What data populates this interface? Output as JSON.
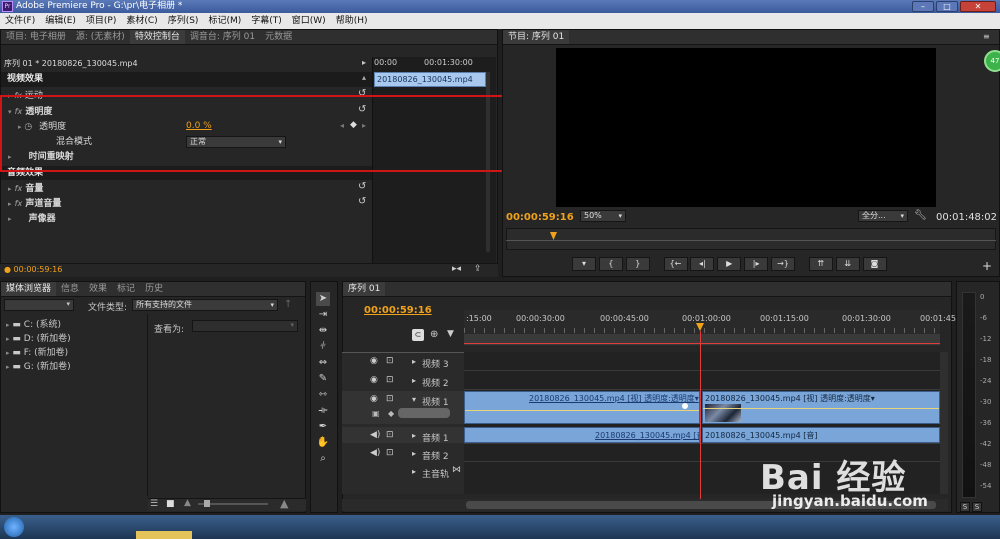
{
  "window": {
    "title": "Adobe Premiere Pro - G:\\pr\\电子相册 *",
    "logo": "Pr"
  },
  "menu": [
    "文件(F)",
    "编辑(E)",
    "项目(P)",
    "素材(C)",
    "序列(S)",
    "标记(M)",
    "字幕(T)",
    "窗口(W)",
    "帮助(H)"
  ],
  "source_panel": {
    "tabs": [
      "项目: 电子相册",
      "源: (无素材)",
      "特效控制台",
      "调音台: 序列 01",
      "元数据"
    ],
    "sequence_clip": "序列 01 * 20180826_130045.mp4",
    "video_effects_label": "视频效果",
    "effects": {
      "motion": "运动",
      "opacity": "透明度",
      "opacity_param": "透明度",
      "opacity_value": "0.0 %",
      "blend_mode_label": "混合模式",
      "blend_mode_value": "正常",
      "time_remap": "时间重映射"
    },
    "audio_effects_label": "音频效果",
    "audio": {
      "volume": "音量",
      "channel_volume": "声道音量",
      "panner": "声像器"
    },
    "mini_timeline": {
      "t0": "00:00",
      "t1": "00:01:30:00",
      "clip": "20180826_130045.mp4"
    },
    "timecode": "00:00:59:16"
  },
  "program_panel": {
    "tab": "节目: 序列 01",
    "current_time": "00:00:59:16",
    "zoom": "50%",
    "quality": "全分...",
    "duration": "00:01:48:02",
    "controls": [
      "marker",
      "in",
      "out",
      "go-in",
      "step-back",
      "play",
      "step-fwd",
      "go-out",
      "lift",
      "extract",
      "export-frame"
    ]
  },
  "media_browser": {
    "tabs": [
      "媒体浏览器",
      "信息",
      "效果",
      "标记",
      "历史"
    ],
    "file_type_label": "文件类型:",
    "file_type_value": "所有支持的文件",
    "view_as_label": "查看为:",
    "drives": [
      "C: (系统)",
      "D: (新加卷)",
      "F: (新加卷)",
      "G: (新加卷)"
    ]
  },
  "timeline": {
    "tab": "序列 01",
    "timecode": "00:00:59:16",
    "ruler": [
      ":15:00",
      "00:00:30:00",
      "00:00:45:00",
      "00:01:00:00",
      "00:01:15:00",
      "00:01:30:00",
      "00:01:45"
    ],
    "tracks": {
      "v3": "视频 3",
      "v2": "视频 2",
      "v1": "视频 1",
      "a1": "音频 1",
      "a2": "音频 2",
      "master": "主音轨"
    },
    "clips": {
      "v1_a": "20180826_130045.mp4 [视] 透明度:透明度▾",
      "v1_b": "20180826_130045.mp4 [视] 透明度:透明度▾",
      "a1_a": "20180826_130045.mp4 [音]",
      "a1_b": "20180826_130045.mp4 [音]"
    }
  },
  "audio_meter": {
    "ticks": [
      "0",
      "-6",
      "-12",
      "-18",
      "-24",
      "-30",
      "-36",
      "-42",
      "-48",
      "-54"
    ],
    "solo": [
      "S",
      "S"
    ]
  },
  "badge": "47",
  "watermark": {
    "logo": "Bai  经验",
    "url": "jingyan.baidu.com"
  },
  "colors": {
    "accent": "#f0a21a",
    "clip": "#7aa5d8",
    "playhead": "#e03c3c",
    "highlight": "#d01515"
  }
}
